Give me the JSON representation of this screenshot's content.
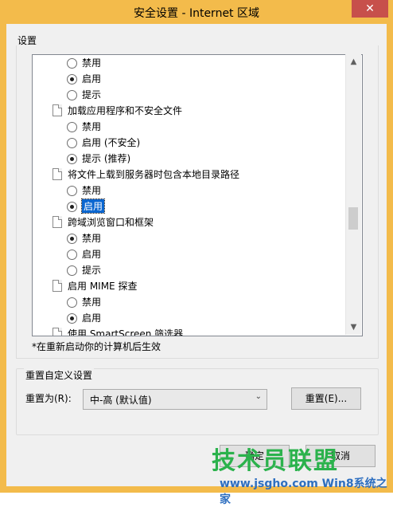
{
  "window": {
    "title": "安全设置 - Internet 区域",
    "close_glyph": "✕"
  },
  "settings": {
    "group_label": "设置",
    "rows": [
      {
        "kind": "radio",
        "checked": false,
        "label": "禁用"
      },
      {
        "kind": "radio",
        "checked": true,
        "label": "启用"
      },
      {
        "kind": "radio",
        "checked": false,
        "label": "提示"
      },
      {
        "kind": "header",
        "label": "加载应用程序和不安全文件"
      },
      {
        "kind": "radio",
        "checked": false,
        "label": "禁用"
      },
      {
        "kind": "radio",
        "checked": false,
        "label": "启用 (不安全)"
      },
      {
        "kind": "radio",
        "checked": true,
        "label": "提示 (推荐)"
      },
      {
        "kind": "header",
        "label": "将文件上载到服务器时包含本地目录路径"
      },
      {
        "kind": "radio",
        "checked": false,
        "label": "禁用"
      },
      {
        "kind": "radio",
        "checked": true,
        "label": "启用",
        "selected": true
      },
      {
        "kind": "header",
        "label": "跨域浏览窗口和框架"
      },
      {
        "kind": "radio",
        "checked": true,
        "label": "禁用"
      },
      {
        "kind": "radio",
        "checked": false,
        "label": "启用"
      },
      {
        "kind": "radio",
        "checked": false,
        "label": "提示"
      },
      {
        "kind": "header",
        "label": "启用 MIME 探查"
      },
      {
        "kind": "radio",
        "checked": false,
        "label": "禁用"
      },
      {
        "kind": "radio",
        "checked": true,
        "label": "启用"
      },
      {
        "kind": "header",
        "label": "使用 SmartScreen 筛选器"
      }
    ],
    "note": "*在重新启动你的计算机后生效"
  },
  "reset": {
    "group_label": "重置自定义设置",
    "to_label": "重置为(R):",
    "selected_value": "中-高 (默认值)",
    "reset_button": "重置(E)..."
  },
  "footer": {
    "ok": "确定",
    "cancel": "取消"
  },
  "watermark": {
    "main": "技术员联盟",
    "url": "www.jsgho.com",
    "sub": "Win8系统之家"
  },
  "colors": {
    "title_bar": "#f3bb4b",
    "selection": "#0a66d0",
    "close": "#c7504b"
  }
}
